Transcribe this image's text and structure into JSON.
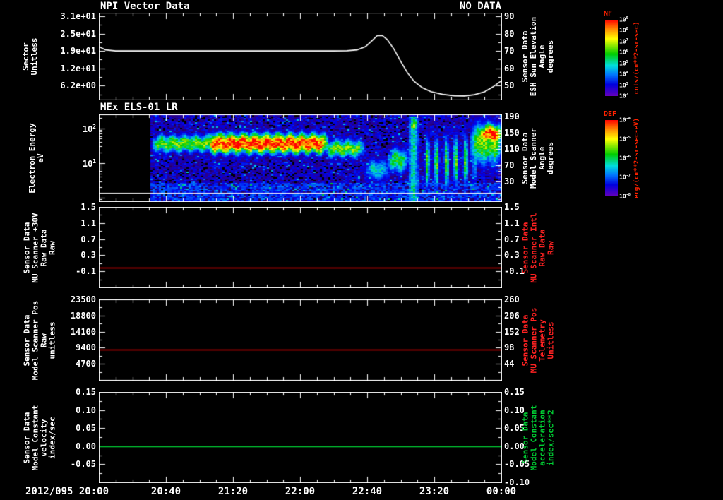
{
  "page": {
    "background": "#000000"
  },
  "x_axis": {
    "start_label": "2012/095 20:00",
    "tick_labels": [
      "20:40",
      "21:20",
      "22:00",
      "22:40",
      "23:20",
      "00:00"
    ],
    "tick_minutes": [
      40,
      80,
      120,
      160,
      200,
      240
    ],
    "minor_step_minutes": 10,
    "total_minutes": 240
  },
  "colorbars": [
    {
      "title": "NF",
      "units": "cnts/(cm**2-sr-sec)",
      "tick_labels": [
        "10^9",
        "10^8",
        "10^7",
        "10^6",
        "10^5",
        "10^4",
        "10^3",
        "10^2"
      ]
    },
    {
      "title": "DEF",
      "units": "erg/(cm**2-sr-sec-eV)",
      "tick_labels": [
        "10^-4",
        "10^-5",
        "10^-6",
        "10^-7",
        "10^-8"
      ]
    }
  ],
  "chart_data": [
    {
      "id": "npi-sun-elevation",
      "type": "line",
      "title": "NPI Vector Data",
      "status": "NO DATA",
      "line_color": "#ffffff",
      "left_axis": {
        "label_lines": [
          "Sector",
          "Unitless"
        ],
        "tick_labels": [
          "3.1e+01",
          "2.5e+01",
          "1.9e+01",
          "1.2e+01",
          "6.2e+00"
        ],
        "ticks": [
          31,
          25,
          19,
          12,
          6.2
        ],
        "tick_fracs": [
          0.04,
          0.24,
          0.44,
          0.64,
          0.84
        ]
      },
      "right_axis": {
        "label_lines": [
          "Sensor Data",
          "ESH Sun Elevation",
          "Angle",
          "degrees"
        ],
        "tick_labels": [
          "90",
          "80",
          "70",
          "60",
          "50"
        ],
        "ticks": [
          90,
          80,
          70,
          60,
          50
        ],
        "tick_fracs": [
          0.04,
          0.24,
          0.44,
          0.64,
          0.84
        ],
        "range": [
          92,
          42
        ],
        "color": "#ffffff"
      },
      "series": {
        "x_minutes": [
          0,
          4,
          10,
          40,
          80,
          120,
          140,
          148,
          154,
          159,
          163,
          166,
          169,
          172,
          176,
          180,
          184,
          188,
          193,
          198,
          205,
          212,
          218,
          224,
          230,
          235,
          240
        ],
        "y_degrees": [
          72.5,
          70.6,
          70,
          70,
          70,
          70,
          70,
          70.1,
          70.6,
          72.5,
          76,
          78.8,
          78.9,
          76.5,
          71,
          64,
          57.5,
          52.5,
          48.8,
          46.6,
          45,
          44.2,
          44.1,
          44.8,
          46.5,
          49.3,
          52.8
        ]
      }
    },
    {
      "id": "els-spectrogram",
      "type": "heatmap",
      "title": "MEx ELS-01 LR",
      "left_axis": {
        "label_lines": [
          "Electron Energy",
          "eV"
        ],
        "tick_labels": [
          "10^2",
          "10^1"
        ],
        "tick_fracs": [
          0.16,
          0.56
        ],
        "log10_range": [
          2.4,
          -0.1
        ]
      },
      "right_axis": {
        "label_lines": [
          "Sensor Data",
          "Model Scanner",
          "Angle",
          "degrees"
        ],
        "tick_labels": [
          "190",
          "150",
          "110",
          "70",
          "30"
        ],
        "ticks": [
          190,
          150,
          110,
          70,
          30
        ],
        "tick_fracs": [
          0.023,
          0.21,
          0.397,
          0.584,
          0.771
        ],
        "color": "#ffffff"
      },
      "data_start_minute": 30,
      "baseline_frac": 0.9,
      "background": {
        "intensity": 0.16,
        "low_energy_boost": 0.09
      },
      "features": [
        {
          "name": "band-early",
          "t_min": [
            31,
            68
          ],
          "log10_e": [
            1.3,
            1.85
          ],
          "intensity": 0.62
        },
        {
          "name": "main-electron-band",
          "t_min": [
            64,
            136
          ],
          "log10_e": [
            1.28,
            1.88
          ],
          "intensity": 0.99
        },
        {
          "name": "band-fade",
          "t_min": [
            134,
            158
          ],
          "log10_e": [
            1.15,
            1.72
          ],
          "intensity": 0.6
        },
        {
          "name": "low-energy-dip",
          "t_min": [
            158,
            173
          ],
          "log10_e": [
            0.45,
            1.2
          ],
          "intensity": 0.4
        },
        {
          "name": "pre-burst-blob",
          "t_min": [
            171,
            184
          ],
          "log10_e": [
            0.7,
            1.5
          ],
          "intensity": 0.55
        },
        {
          "name": "burst-column",
          "t_min": [
            184,
            190
          ],
          "log10_e": [
            -0.1,
            2.35
          ],
          "intensity": 0.55,
          "flat": true
        },
        {
          "name": "burst-core",
          "t_min": [
            185,
            189
          ],
          "log10_e": [
            1.9,
            2.35
          ],
          "intensity": 0.97
        },
        {
          "name": "striped-flux",
          "t_min": [
            191,
            225
          ],
          "log10_e": [
            0.2,
            1.9
          ],
          "intensity": 0.6,
          "striped": true
        },
        {
          "name": "end-halo",
          "t_min": [
            221,
            240
          ],
          "log10_e": [
            0.9,
            2.25
          ],
          "intensity": 0.62
        },
        {
          "name": "end-core",
          "t_min": [
            226,
            240
          ],
          "log10_e": [
            1.55,
            2.15
          ],
          "intensity": 0.99
        }
      ],
      "colorbar": "DEF"
    },
    {
      "id": "mu-scanner-30v",
      "type": "line",
      "line_color": "#dd0000",
      "constant_value": 0.0,
      "left_axis": {
        "label_lines": [
          "Sensor Data",
          "MU Scanner +30V",
          "Raw Data",
          "Raw"
        ],
        "tick_labels": [
          "1.5",
          "1.1",
          "0.7",
          "0.3",
          "-0.1"
        ],
        "ticks": [
          1.5,
          1.1,
          0.7,
          0.3,
          -0.1
        ],
        "tick_fracs": [
          0,
          0.2,
          0.4,
          0.6,
          0.8
        ],
        "range": [
          1.5,
          -0.5
        ]
      },
      "right_axis": {
        "label_lines": [
          "Sensor Data",
          "MU Scanner Intl",
          "Raw Data",
          "Raw"
        ],
        "tick_labels": [
          "1.5",
          "1.1",
          "0.7",
          "0.3",
          "-0.1"
        ],
        "ticks": [
          1.5,
          1.1,
          0.7,
          0.3,
          -0.1
        ],
        "tick_fracs": [
          0,
          0.2,
          0.4,
          0.6,
          0.8
        ],
        "color": "#ff2222"
      }
    },
    {
      "id": "model-scanner-pos",
      "type": "line",
      "line_color": "#dd0000",
      "constant_value": 8800,
      "left_axis": {
        "label_lines": [
          "Sensor Data",
          "Model Scanner Pos",
          "Raw",
          "unitless"
        ],
        "tick_labels": [
          "23500",
          "18800",
          "14100",
          "9400",
          "4700"
        ],
        "ticks": [
          23500,
          18800,
          14100,
          9400,
          4700
        ],
        "tick_fracs": [
          0,
          0.2,
          0.4,
          0.6,
          0.8
        ],
        "range": [
          23500,
          0
        ]
      },
      "right_axis": {
        "label_lines": [
          "Sensor Data",
          "MU Scanner Pos",
          "Telemetry",
          "Unitless"
        ],
        "tick_labels": [
          "260",
          "206",
          "152",
          "98",
          "44"
        ],
        "ticks": [
          260,
          206,
          152,
          98,
          44
        ],
        "tick_fracs": [
          0,
          0.2,
          0.4,
          0.6,
          0.8
        ],
        "color": "#ff2222"
      }
    },
    {
      "id": "model-constant-velocity",
      "type": "line",
      "line_color": "#00cc33",
      "constant_value": 0.0,
      "left_axis": {
        "label_lines": [
          "Sensor Data",
          "Model Constant",
          "velocity",
          "index/sec"
        ],
        "tick_labels": [
          "0.15",
          "0.10",
          "0.05",
          "0.00",
          "-0.05"
        ],
        "ticks": [
          0.15,
          0.1,
          0.05,
          0.0,
          -0.05
        ],
        "tick_fracs": [
          0,
          0.2,
          0.4,
          0.6,
          0.8
        ],
        "range": [
          0.15,
          -0.1
        ]
      },
      "right_axis": {
        "label_lines": [
          "Sensor Data",
          "Model Constant",
          "acceleration",
          "index/sec**2"
        ],
        "tick_labels": [
          "0.15",
          "0.10",
          "0.05",
          "0.00",
          "-0.05",
          "-0.10"
        ],
        "ticks": [
          0.15,
          0.1,
          0.05,
          0.0,
          -0.05,
          -0.1
        ],
        "tick_fracs": [
          0,
          0.2,
          0.4,
          0.6,
          0.8,
          1.0
        ],
        "color": "#00cc33"
      }
    }
  ]
}
